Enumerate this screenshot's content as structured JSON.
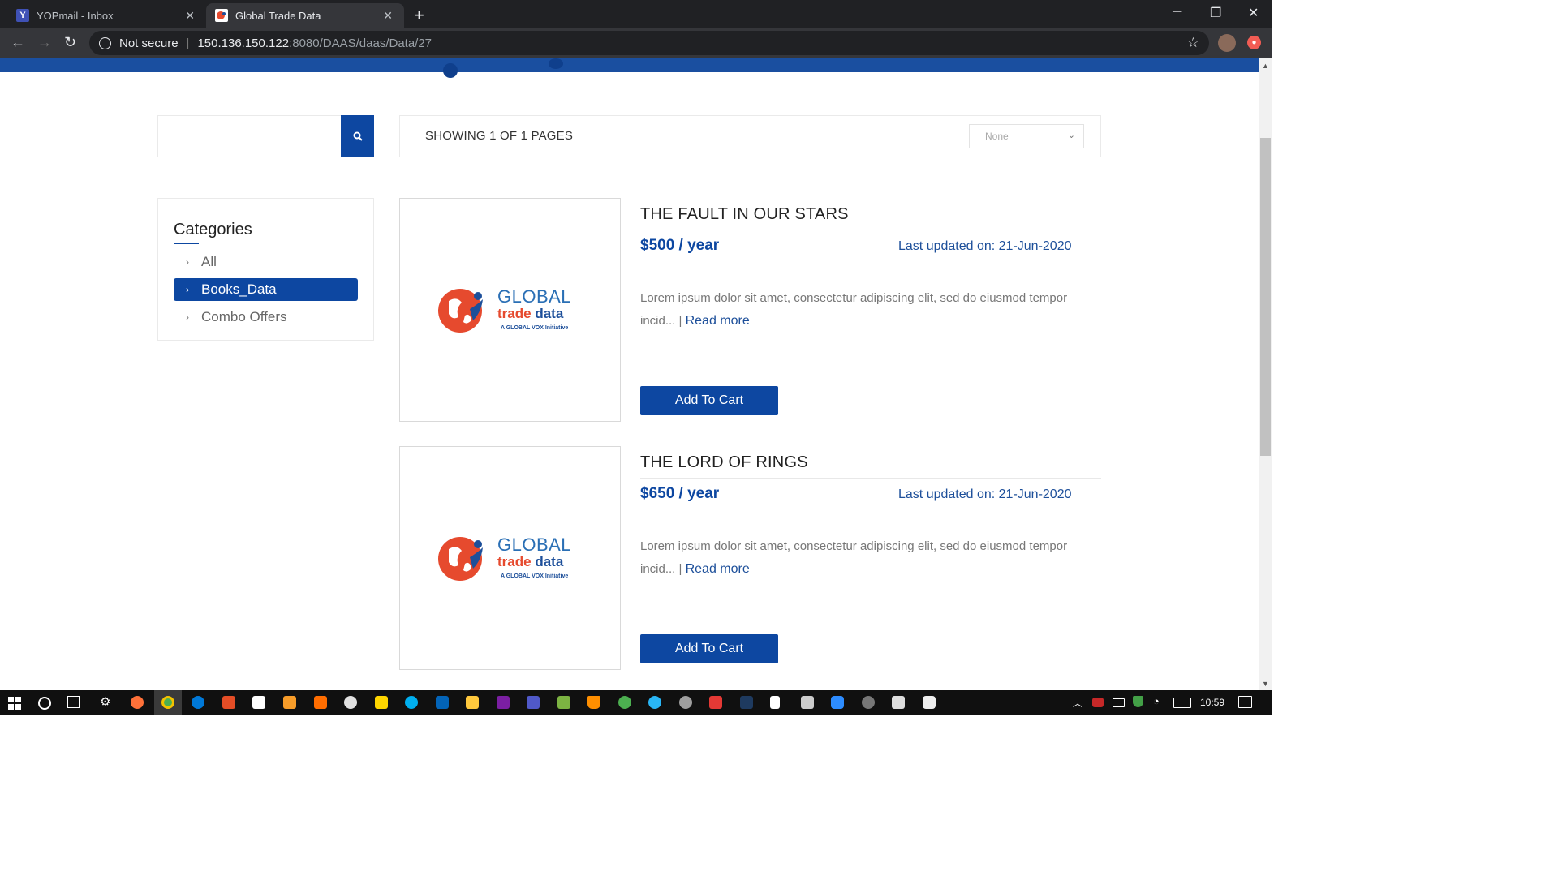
{
  "browser": {
    "tabs": [
      {
        "title": "YOPmail - Inbox",
        "favicon": "Y",
        "active": false
      },
      {
        "title": "Global Trade Data",
        "favicon": "globe-logo",
        "active": true
      }
    ],
    "address": {
      "security": "Not secure",
      "host": "150.136.150.122",
      "path": ":8080/DAAS/daas/Data/27"
    }
  },
  "toolbar": {
    "showing_text": "SHOWING 1 OF 1 PAGES",
    "sort_value": "None",
    "search_placeholder": ""
  },
  "categories": {
    "title": "Categories",
    "items": [
      {
        "label": "All",
        "active": false
      },
      {
        "label": "Books_Data",
        "active": true
      },
      {
        "label": "Combo Offers",
        "active": false
      }
    ]
  },
  "logo": {
    "line1": "GLOBAL",
    "line2a": "trade",
    "line2b": "data",
    "line3": "A GLOBAL VOX Initiative"
  },
  "products": [
    {
      "title": "THE FAULT IN OUR STARS",
      "price": "$500 / year",
      "updated": "Last updated on: 21-Jun-2020",
      "desc": "Lorem ipsum dolor sit amet, consectetur adipiscing elit, sed do eiusmod tempor incid... |",
      "read_more": "Read more",
      "button": "Add To Cart"
    },
    {
      "title": "THE LORD OF RINGS",
      "price": "$650 / year",
      "updated": "Last updated on: 21-Jun-2020",
      "desc": "Lorem ipsum dolor sit amet, consectetur adipiscing elit, sed do eiusmod tempor incid... |",
      "read_more": "Read more",
      "button": "Add To Cart"
    }
  ],
  "taskbar": {
    "time": "10:59"
  },
  "colors": {
    "primary": "#0d47a1",
    "browser_dark": "#202124",
    "toolbar": "#35363a"
  }
}
